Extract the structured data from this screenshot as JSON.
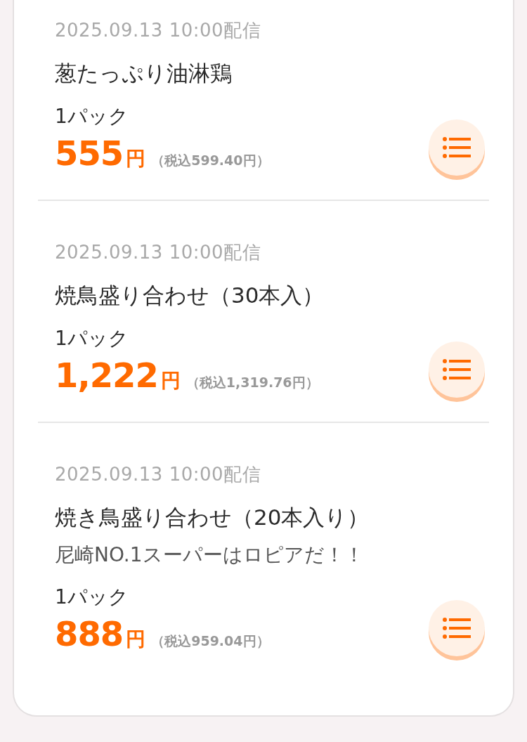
{
  "items": [
    {
      "date": "2025.09.13 10:00配信",
      "name": "葱たっぷり油淋鶏",
      "unit": "1パック",
      "price": "555",
      "currency": "円",
      "tax_note": "（税込599.40円）"
    },
    {
      "date": "2025.09.13 10:00配信",
      "name": "焼鳥盛り合わせ（30本入）",
      "unit": "1パック",
      "price": "1,222",
      "currency": "円",
      "tax_note": "（税込1,319.76円）"
    },
    {
      "date": "2025.09.13 10:00配信",
      "name": "焼き鳥盛り合わせ（20本入り）",
      "description": "尼崎NO.1スーパーはロピアだ！！",
      "unit": "1パック",
      "price": "888",
      "currency": "円",
      "tax_note": "（税込959.04円）"
    }
  ]
}
